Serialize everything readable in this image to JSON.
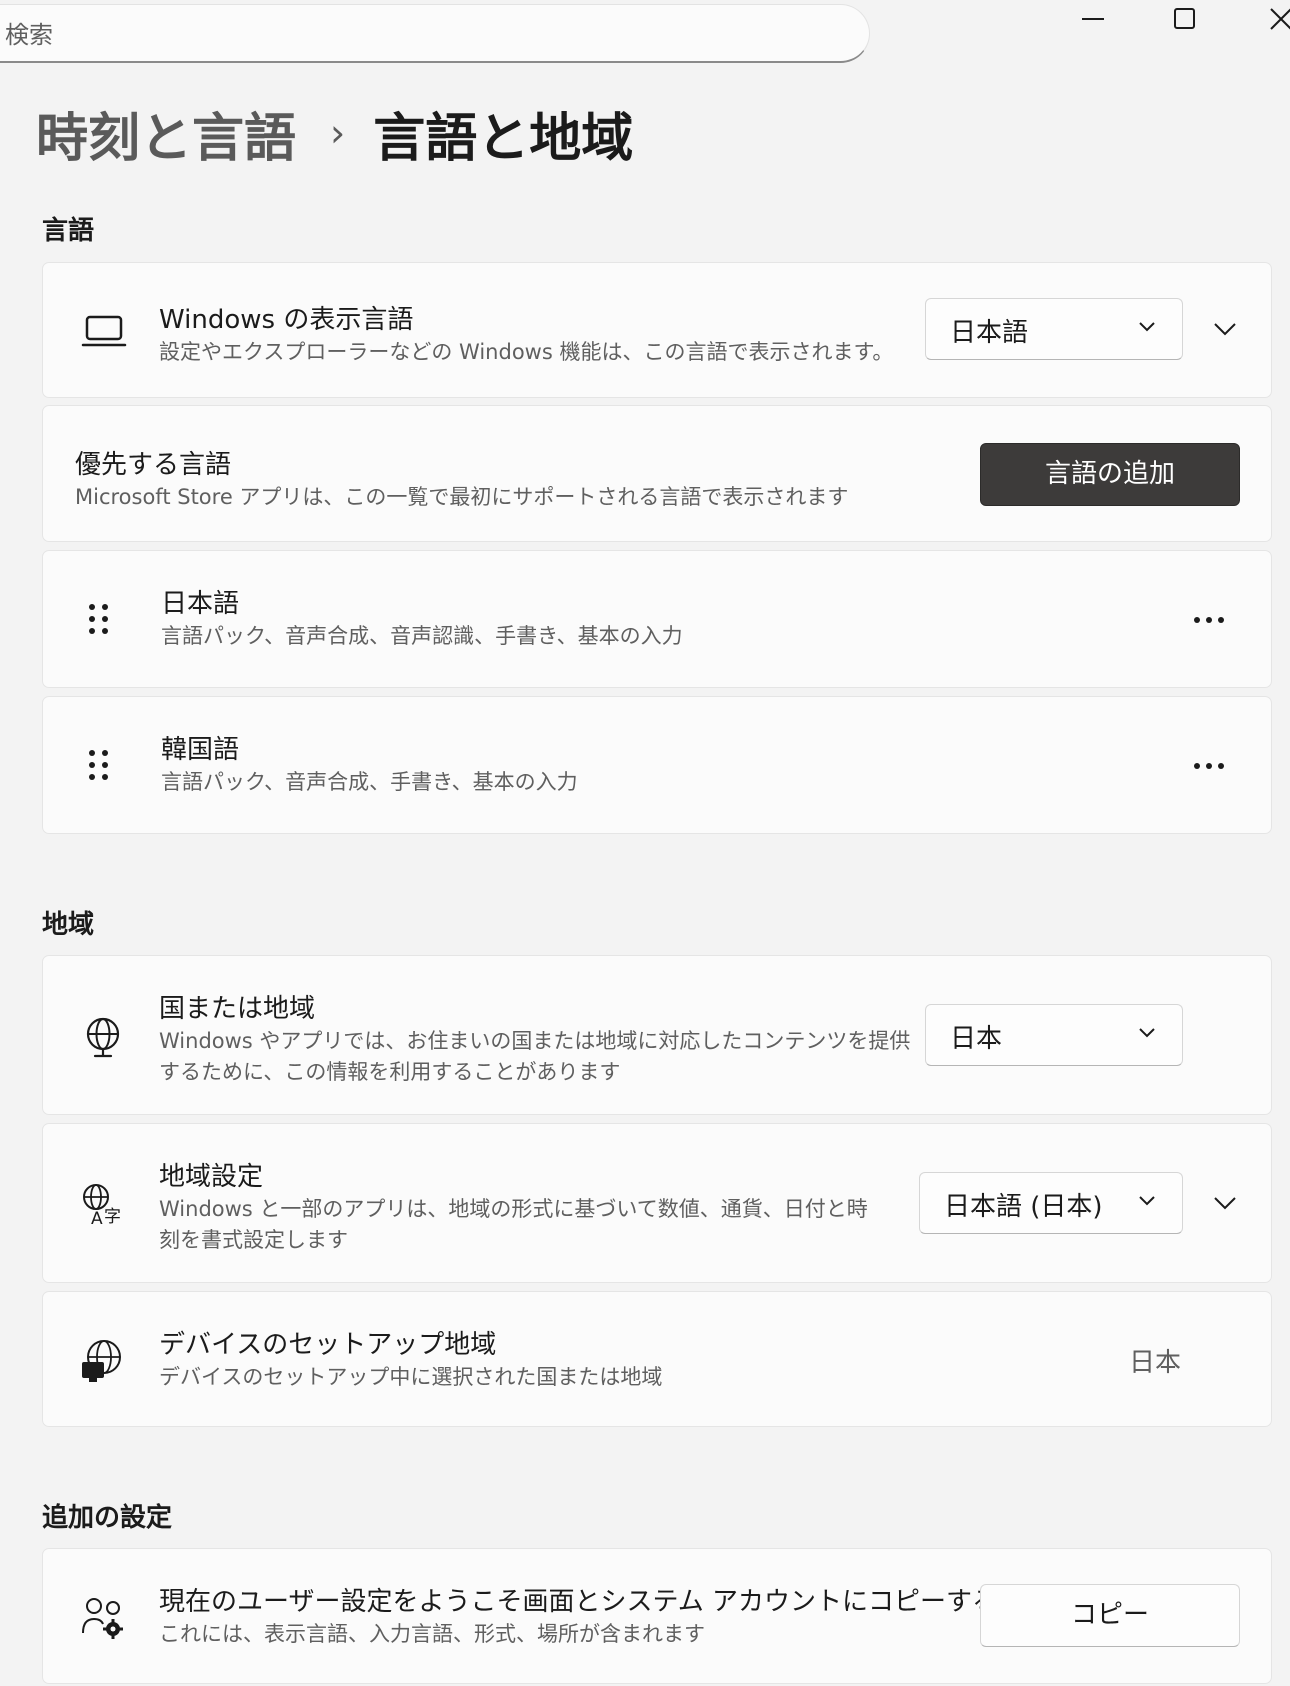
{
  "search": {
    "placeholder": "検索"
  },
  "breadcrumb": {
    "parent": "時刻と言語",
    "separator": "›",
    "current": "言語と地域"
  },
  "sections": {
    "language": "言語",
    "region": "地域",
    "additional": "追加の設定"
  },
  "display_language": {
    "title": "Windows の表示言語",
    "description": "設定やエクスプローラーなどの Windows 機能は、この言語で表示されます。",
    "selected": "日本語",
    "icon": "laptop-icon"
  },
  "preferred": {
    "title": "優先する言語",
    "description": "Microsoft Store アプリは、この一覧で最初にサポートされる言語で表示されます",
    "add_button": "言語の追加"
  },
  "languages": [
    {
      "name": "日本語",
      "features": "言語パック、音声合成、音声認識、手書き、基本の入力"
    },
    {
      "name": "韓国語",
      "features": "言語パック、音声合成、手書き、基本の入力"
    }
  ],
  "country": {
    "title": "国または地域",
    "description_line1": "Windows やアプリでは、お住まいの国または地域に対応したコンテンツを提供",
    "description_line2": "するために、この情報を利用することがあります",
    "selected": "日本",
    "icon": "globe-icon"
  },
  "regional_format": {
    "title": "地域設定",
    "description_line1": "Windows と一部のアプリは、地域の形式に基づいて数値、通貨、日付と時",
    "description_line2": "刻を書式設定します",
    "selected": "日本語 (日本)",
    "icon": "globe-language-icon"
  },
  "setup_region": {
    "title": "デバイスのセットアップ地域",
    "description": "デバイスのセットアップ中に選択された国または地域",
    "value": "日本",
    "icon": "globe-device-icon"
  },
  "copy_settings": {
    "title": "現在のユーザー設定をようこそ画面とシステム アカウントにコピーする",
    "description": "これには、表示言語、入力言語、形式、場所が含まれます",
    "button": "コピー",
    "icon": "users-gear-icon"
  }
}
